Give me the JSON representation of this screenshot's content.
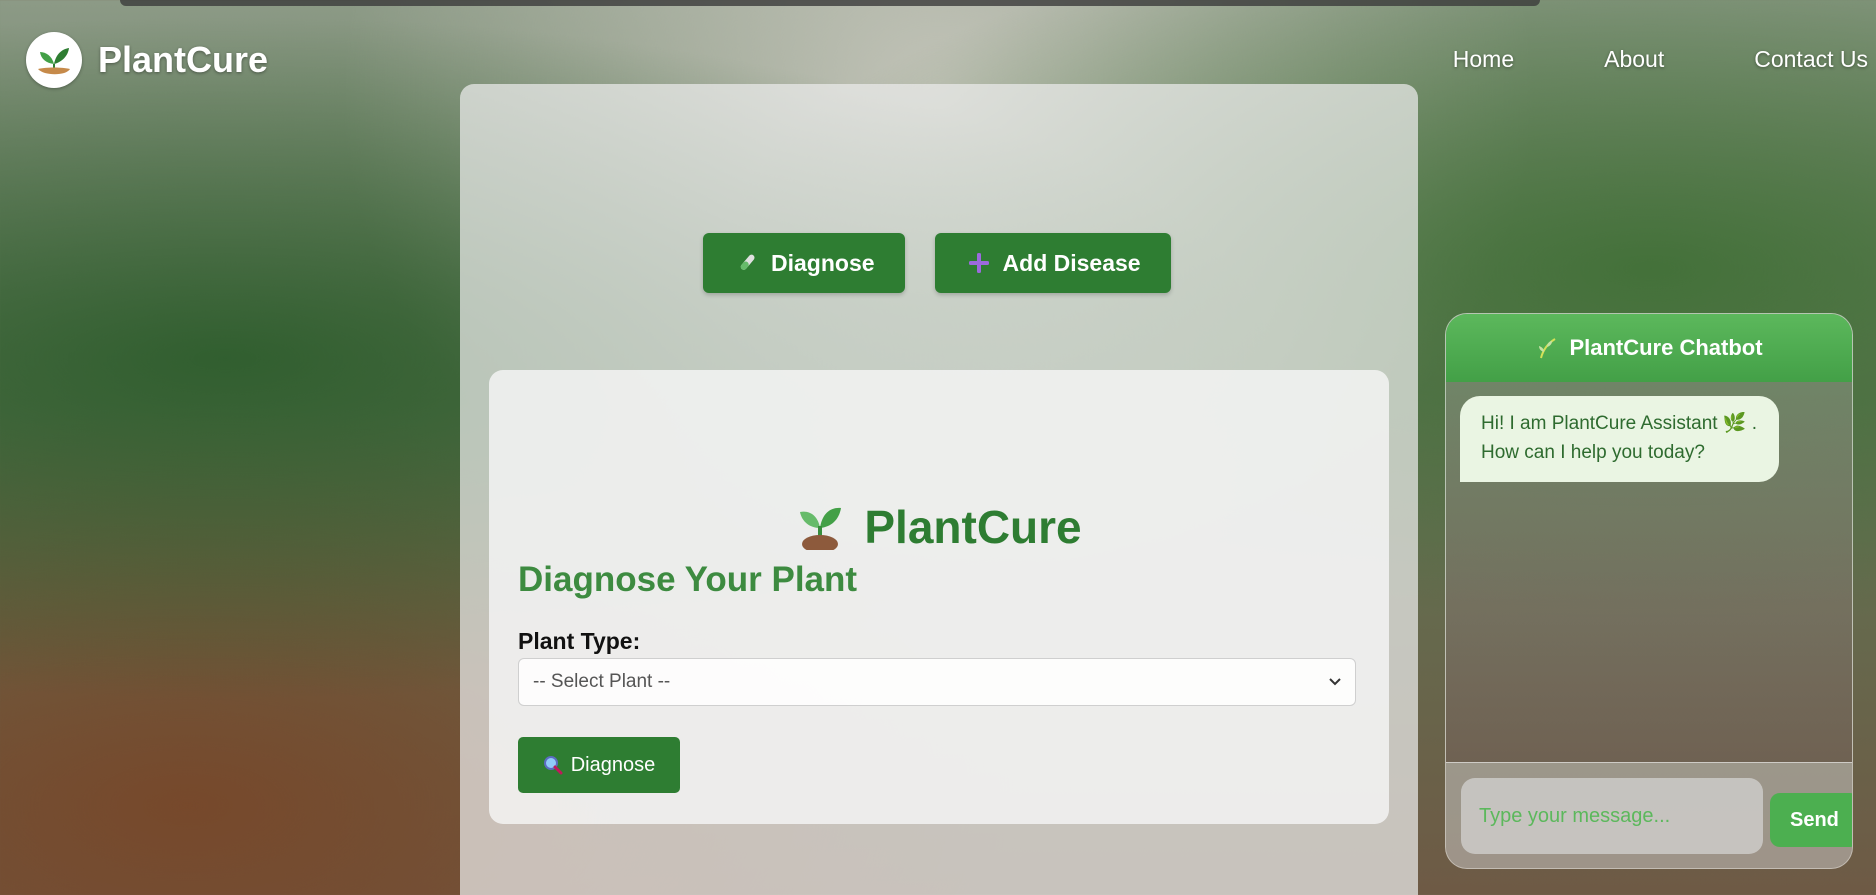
{
  "navbar": {
    "brand": "PlantCure",
    "links": [
      "Home",
      "About",
      "Contact Us"
    ]
  },
  "actions": {
    "diagnose_label": "Diagnose",
    "add_disease_label": "Add Disease"
  },
  "diagnose_card": {
    "logo_title": "PlantCure",
    "heading": "Diagnose Your Plant",
    "plant_type_label": "Plant Type:",
    "select_value": "-- Select Plant --",
    "button_label": "Diagnose"
  },
  "chatbot": {
    "title": "PlantCure Chatbot",
    "greeting_line1": "Hi! I am PlantCure Assistant 🌿 .",
    "greeting_line2": "How can I help you today?",
    "input_placeholder": "Type your message...",
    "send_label": "Send"
  },
  "colors": {
    "primary_green": "#2e7d32",
    "chat_green": "#4caf50",
    "heading_green": "#3d8b40"
  },
  "icons": [
    "plant-hand-logo-icon",
    "test-tube-icon",
    "plus-icon",
    "sprout-icon",
    "chevron-down-icon",
    "magnifier-icon",
    "herb-icon"
  ]
}
